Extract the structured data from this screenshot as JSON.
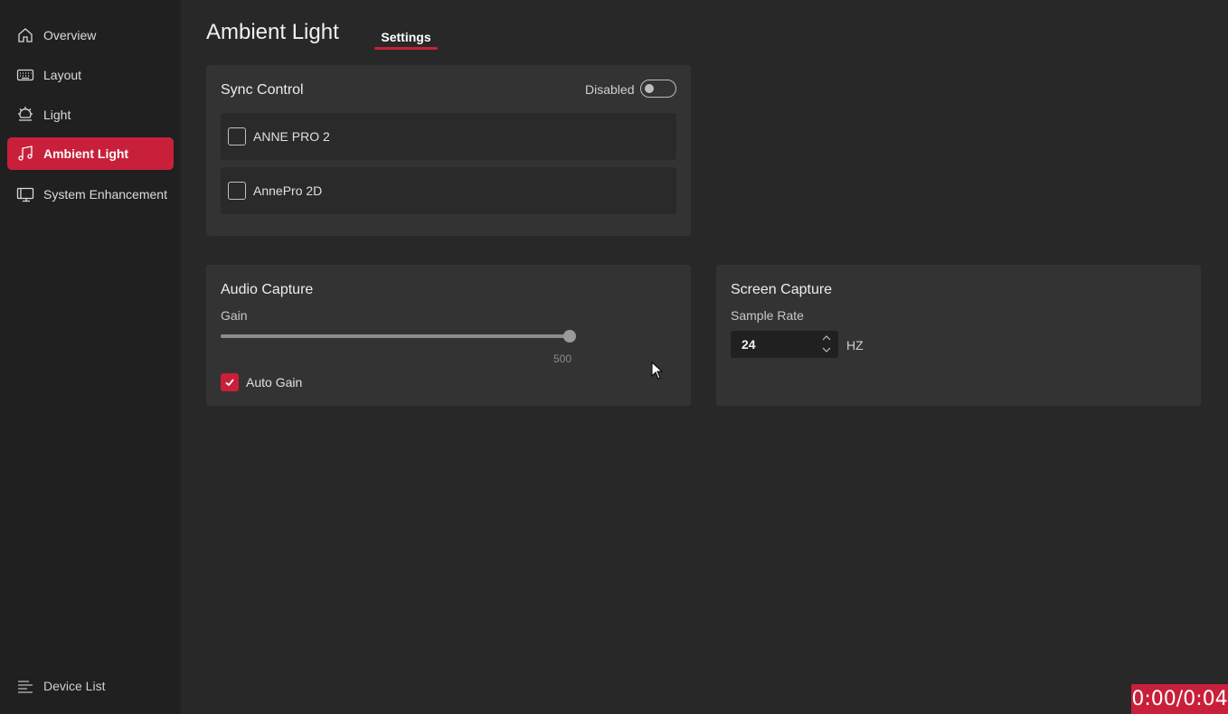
{
  "sidebar": {
    "items": [
      {
        "label": "Overview",
        "icon": "home-icon"
      },
      {
        "label": "Layout",
        "icon": "keyboard-icon"
      },
      {
        "label": "Light",
        "icon": "sun-icon"
      },
      {
        "label": "Ambient Light",
        "icon": "music-note-icon",
        "active": true
      },
      {
        "label": "System Enhancement",
        "icon": "monitor-icon"
      }
    ],
    "device_list": {
      "label": "Device List",
      "icon": "list-icon"
    }
  },
  "header": {
    "title": "Ambient Light",
    "tabs": [
      {
        "label": "Settings",
        "active": true
      }
    ]
  },
  "sync_control": {
    "title": "Sync Control",
    "toggle_label": "Disabled",
    "toggle_on": false,
    "devices": [
      {
        "name": "ANNE PRO 2",
        "checked": false
      },
      {
        "name": "AnnePro 2D",
        "checked": false
      }
    ]
  },
  "audio_capture": {
    "title": "Audio Capture",
    "gain_label": "Gain",
    "gain_value": "500",
    "gain_fraction": 1.0,
    "auto_gain_label": "Auto Gain",
    "auto_gain_checked": true
  },
  "screen_capture": {
    "title": "Screen Capture",
    "sample_rate_label": "Sample Rate",
    "sample_rate_value": "24",
    "unit": "HZ"
  },
  "timer": "0:00/0:04",
  "colors": {
    "accent": "#c8203a",
    "background": "#282828",
    "sidebar": "#202020",
    "card": "#333333"
  }
}
